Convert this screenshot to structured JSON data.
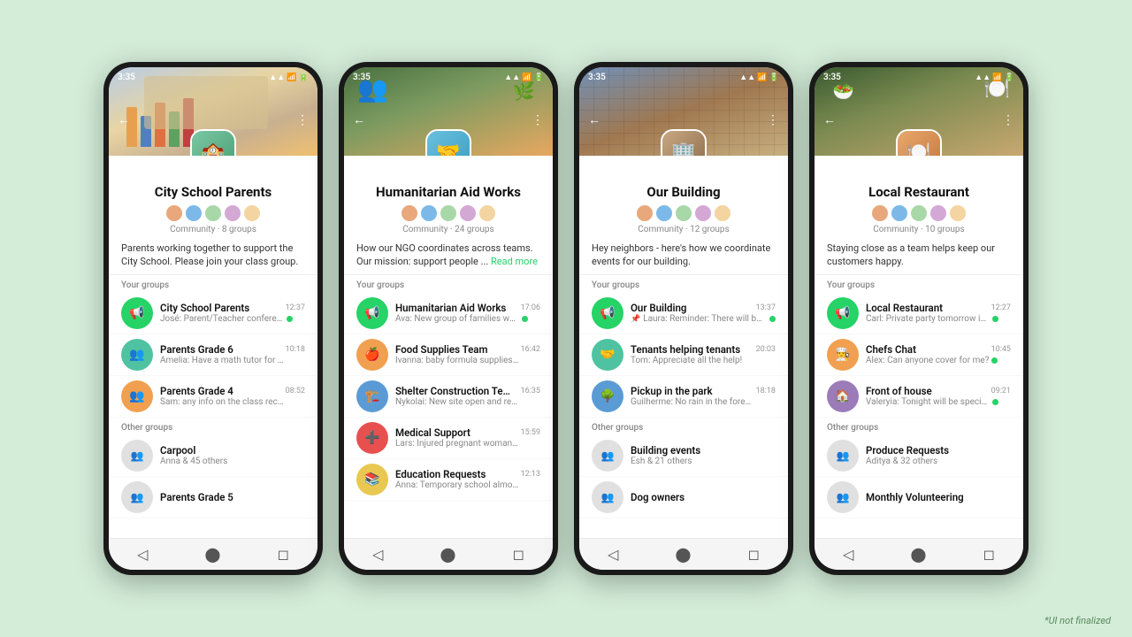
{
  "disclaimer": "*UI not finalized",
  "phones": [
    {
      "id": "phone-school",
      "status_time": "3:35",
      "header_bg": "bg-school",
      "community_icon_class": "icon-school",
      "community_icon_emoji": "🏫",
      "title": "City School Parents",
      "member_count": "Community · 8 groups",
      "description": "Parents working together to support the City School. Please join your class group.",
      "your_groups_label": "Your groups",
      "other_groups_label": "Other groups",
      "your_groups": [
        {
          "name": "City School Parents",
          "preview": "José: Parent/Teacher conferences ...",
          "time": "12:37",
          "avatar_class": "green",
          "avatar_emoji": "📢",
          "has_dot": true,
          "is_pinned": false
        },
        {
          "name": "Parents Grade 6",
          "preview": "Amelia: Have a math tutor for the upco...",
          "time": "10:18",
          "avatar_class": "teal",
          "avatar_emoji": "👥",
          "has_dot": false,
          "is_pinned": false
        },
        {
          "name": "Parents Grade 4",
          "preview": "Sam: any info on the class recital?",
          "time": "08:52",
          "avatar_class": "orange",
          "avatar_emoji": "👥",
          "has_dot": false,
          "is_pinned": false
        }
      ],
      "other_groups": [
        {
          "name": "Carpool",
          "preview": "Anna & 45 others",
          "time": "",
          "avatar_class": "gray",
          "avatar_emoji": "👥",
          "has_dot": false
        },
        {
          "name": "Parents Grade 5",
          "preview": "",
          "time": "",
          "avatar_class": "gray",
          "avatar_emoji": "👥",
          "has_dot": false
        }
      ]
    },
    {
      "id": "phone-humanitarian",
      "status_time": "3:35",
      "header_bg": "bg-humanitarian",
      "community_icon_class": "icon-humanitarian",
      "community_icon_emoji": "🤝",
      "title": "Humanitarian Aid Works",
      "member_count": "Community · 24 groups",
      "description": "How our NGO coordinates across teams. Our mission: support people ...",
      "has_read_more": true,
      "read_more_label": "Read more",
      "your_groups_label": "Your groups",
      "your_groups": [
        {
          "name": "Humanitarian Aid Works",
          "preview": "Ava: New group of families waiting ...",
          "time": "17:06",
          "avatar_class": "green",
          "avatar_emoji": "📢",
          "has_dot": true,
          "is_pinned": false
        },
        {
          "name": "Food Supplies Team",
          "preview": "Ivanna: baby formula supplies running ...",
          "time": "16:42",
          "avatar_class": "orange",
          "avatar_emoji": "🍎",
          "has_dot": false,
          "is_pinned": false
        },
        {
          "name": "Shelter Construction Team",
          "preview": "Nykolai: New site open and ready for ...",
          "time": "16:35",
          "avatar_class": "blue",
          "avatar_emoji": "🏗️",
          "has_dot": false,
          "is_pinned": false
        },
        {
          "name": "Medical Support",
          "preview": "Lars: Injured pregnant woman in need ...",
          "time": "15:59",
          "avatar_class": "red",
          "avatar_emoji": "➕",
          "has_dot": false,
          "is_pinned": false
        },
        {
          "name": "Education Requests",
          "preview": "Anna: Temporary school almost comp...",
          "time": "12:13",
          "avatar_class": "yellow",
          "avatar_emoji": "📚",
          "has_dot": false,
          "is_pinned": false
        }
      ],
      "other_groups": []
    },
    {
      "id": "phone-building",
      "status_time": "3:35",
      "header_bg": "bg-building",
      "community_icon_class": "icon-building",
      "community_icon_emoji": "🏢",
      "title": "Our Building",
      "member_count": "Community · 12 groups",
      "description": "Hey neighbors - here's how we coordinate events for our building.",
      "your_groups_label": "Your groups",
      "other_groups_label": "Other groups",
      "your_groups": [
        {
          "name": "Our Building",
          "preview": "Laura: Reminder: There will be ...",
          "time": "13:37",
          "avatar_class": "green",
          "avatar_emoji": "📢",
          "has_dot": true,
          "is_pinned": true
        },
        {
          "name": "Tenants helping tenants",
          "preview": "Tom: Appreciate all the help!",
          "time": "20:03",
          "avatar_class": "teal",
          "avatar_emoji": "🤝",
          "has_dot": false,
          "is_pinned": false
        },
        {
          "name": "Pickup in the park",
          "preview": "Guilherme: No rain in the forecast!",
          "time": "18:18",
          "avatar_class": "blue",
          "avatar_emoji": "🌳",
          "has_dot": false,
          "is_pinned": false
        }
      ],
      "other_groups": [
        {
          "name": "Building events",
          "preview": "Esh & 21 others",
          "time": "",
          "avatar_class": "gray",
          "avatar_emoji": "👥",
          "has_dot": false
        },
        {
          "name": "Dog owners",
          "preview": "",
          "time": "",
          "avatar_class": "gray",
          "avatar_emoji": "👥",
          "has_dot": false
        }
      ]
    },
    {
      "id": "phone-restaurant",
      "status_time": "3:35",
      "header_bg": "bg-restaurant",
      "community_icon_class": "icon-restaurant",
      "community_icon_emoji": "🍽️",
      "title": "Local Restaurant",
      "member_count": "Community · 10 groups",
      "description": "Staying close as a team helps keep our customers happy.",
      "your_groups_label": "Your groups",
      "other_groups_label": "Other groups",
      "your_groups": [
        {
          "name": "Local Restaurant",
          "preview": "Carl: Private party tomorrow in the ...",
          "time": "12:27",
          "avatar_class": "green",
          "avatar_emoji": "📢",
          "has_dot": true,
          "is_pinned": false
        },
        {
          "name": "Chefs Chat",
          "preview": "Alex: Can anyone cover for me?",
          "time": "10:45",
          "avatar_class": "orange",
          "avatar_emoji": "👨‍🍳",
          "has_dot": true,
          "is_pinned": false
        },
        {
          "name": "Front of house",
          "preview": "Valeryia: Tonight will be special!",
          "time": "09:21",
          "avatar_class": "purple",
          "avatar_emoji": "🏠",
          "has_dot": true,
          "is_pinned": false
        }
      ],
      "other_groups": [
        {
          "name": "Produce Requests",
          "preview": "Aditya & 32 others",
          "time": "",
          "avatar_class": "gray",
          "avatar_emoji": "👥",
          "has_dot": false
        },
        {
          "name": "Monthly Volunteering",
          "preview": "",
          "time": "",
          "avatar_class": "gray",
          "avatar_emoji": "👥",
          "has_dot": false
        }
      ]
    }
  ]
}
